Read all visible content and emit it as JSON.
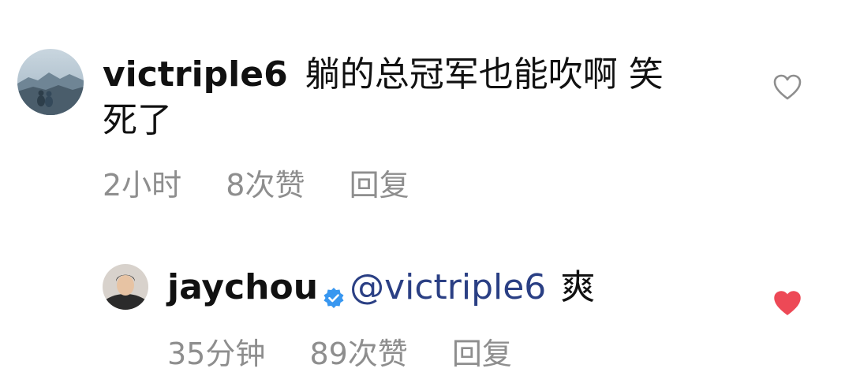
{
  "comments": [
    {
      "username": "victriple6",
      "text_line1": "躺的总冠军也能吹啊 笑",
      "text_line2": "死了",
      "time": "2小时",
      "likes": "8次赞",
      "reply_label": "回复",
      "liked": false,
      "avatar_icon": "landscape-avatar"
    },
    {
      "username": "jaychou",
      "verified": true,
      "mention": "@victriple6",
      "text": "爽",
      "time": "35分钟",
      "likes": "89次赞",
      "reply_label": "回复",
      "liked": true,
      "avatar_icon": "person-avatar"
    }
  ],
  "colors": {
    "username": "#111111",
    "meta": "#8e8e8e",
    "mention": "#2a3f84",
    "heart_liked": "#ed4956",
    "heart_unliked": "#8e8e8e",
    "verified": "#3897f0"
  }
}
